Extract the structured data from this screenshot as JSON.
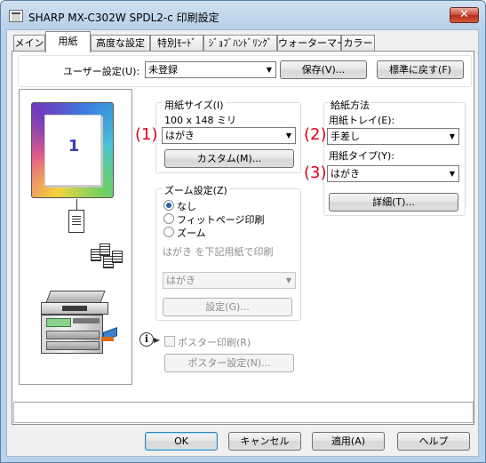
{
  "window": {
    "title": "SHARP MX-C302W SPDL2-c 印刷設定",
    "close_glyph": "✕"
  },
  "tabs": [
    {
      "label": "メイン"
    },
    {
      "label": "用紙"
    },
    {
      "label": "高度な設定"
    },
    {
      "label": "特別ﾓｰﾄﾞ"
    },
    {
      "label": "ｼﾞｮﾌﾞﾊﾝﾄﾞﾘﾝｸﾞ"
    },
    {
      "label": "ウォーターマーク"
    },
    {
      "label": "カラー"
    }
  ],
  "user_settings": {
    "label": "ユーザー設定(U):",
    "value": "未登録",
    "save_label": "保存(V)...",
    "reset_label": "標準に戻す(F)"
  },
  "preview": {
    "page_number": "1"
  },
  "paper_size": {
    "group_label": "用紙サイズ(I)",
    "dimensions": "100 x 148 ミリ",
    "value": "はがき",
    "custom_label": "カスタム(M)..."
  },
  "zoom": {
    "group_label": "ズーム設定(Z)",
    "options": [
      {
        "label": "なし",
        "checked": true
      },
      {
        "label": "フィットページ印刷",
        "checked": false
      },
      {
        "label": "ズーム",
        "checked": false
      }
    ],
    "print_on_label": "はがき を下記用紙で印刷",
    "target_value": "はがき",
    "settings_label": "設定(G)..."
  },
  "poster": {
    "checkbox_label": "ポスター印刷(R)",
    "settings_label": "ポスター設定(N)...",
    "info_icon": "i"
  },
  "paper_source": {
    "group_label": "給紙方法",
    "tray_label": "用紙トレイ(E):",
    "tray_value": "手差し",
    "type_label": "用紙タイプ(Y):",
    "type_value": "はがき",
    "details_label": "詳細(T)..."
  },
  "annotations": {
    "one": "(1)",
    "two": "(2)",
    "three": "(3)"
  },
  "footer": {
    "ok_label": "OK",
    "cancel_label": "キャンセル",
    "apply_label": "適用(A)",
    "help_label": "ヘルプ"
  },
  "colors": {
    "accent_red": "#e0001b",
    "title_gradient": "#b9d1ea",
    "close_red": "#c74837"
  }
}
